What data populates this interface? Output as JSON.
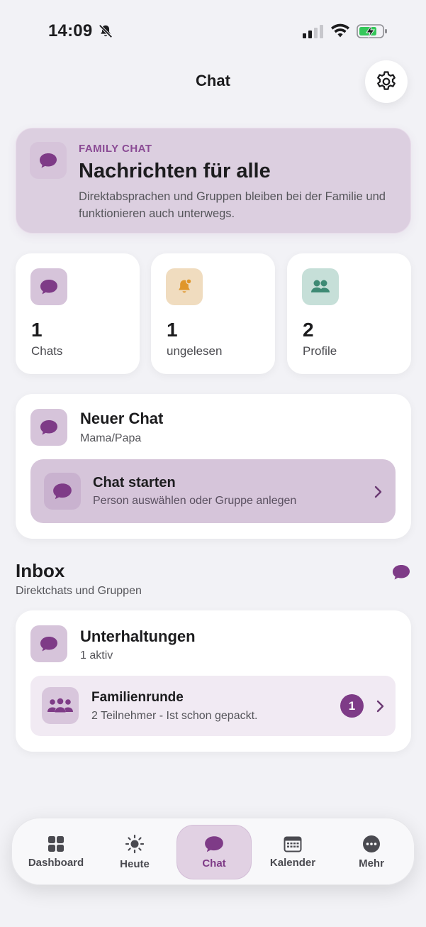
{
  "status_bar": {
    "time": "14:09"
  },
  "header": {
    "title": "Chat"
  },
  "hero": {
    "eyebrow": "FAMILY CHAT",
    "title": "Nachrichten für alle",
    "description": "Direktabsprachen und Gruppen bleiben bei der Familie und funktionieren auch unterwegs."
  },
  "stats": [
    {
      "value": "1",
      "label": "Chats",
      "icon": "chat-bubble-icon"
    },
    {
      "value": "1",
      "label": "ungelesen",
      "icon": "bell-icon"
    },
    {
      "value": "2",
      "label": "Profile",
      "icon": "people-icon"
    }
  ],
  "new_chat": {
    "title": "Neuer Chat",
    "subtitle": "Mama/Papa",
    "start": {
      "title": "Chat starten",
      "subtitle": "Person auswählen oder Gruppe anlegen"
    }
  },
  "inbox": {
    "title": "Inbox",
    "subtitle": "Direktchats und Gruppen",
    "card": {
      "title": "Unterhaltungen",
      "subtitle": "1 aktiv",
      "conversations": [
        {
          "name": "Familienrunde",
          "preview": "2 Teilnehmer - Ist schon gepackt.",
          "unread": "1"
        }
      ]
    }
  },
  "tabs": [
    {
      "label": "Dashboard",
      "icon": "grid-icon"
    },
    {
      "label": "Heute",
      "icon": "sun-icon"
    },
    {
      "label": "Chat",
      "icon": "chat-bubble-icon",
      "active": true
    },
    {
      "label": "Kalender",
      "icon": "calendar-icon"
    },
    {
      "label": "Mehr",
      "icon": "more-icon"
    }
  ],
  "colors": {
    "accent": "#7e3b87",
    "background": "#f2f2f6",
    "hero": "#dccfe0",
    "warning_tile": "#f0dcbf",
    "success_tile": "#c6dfd8"
  }
}
